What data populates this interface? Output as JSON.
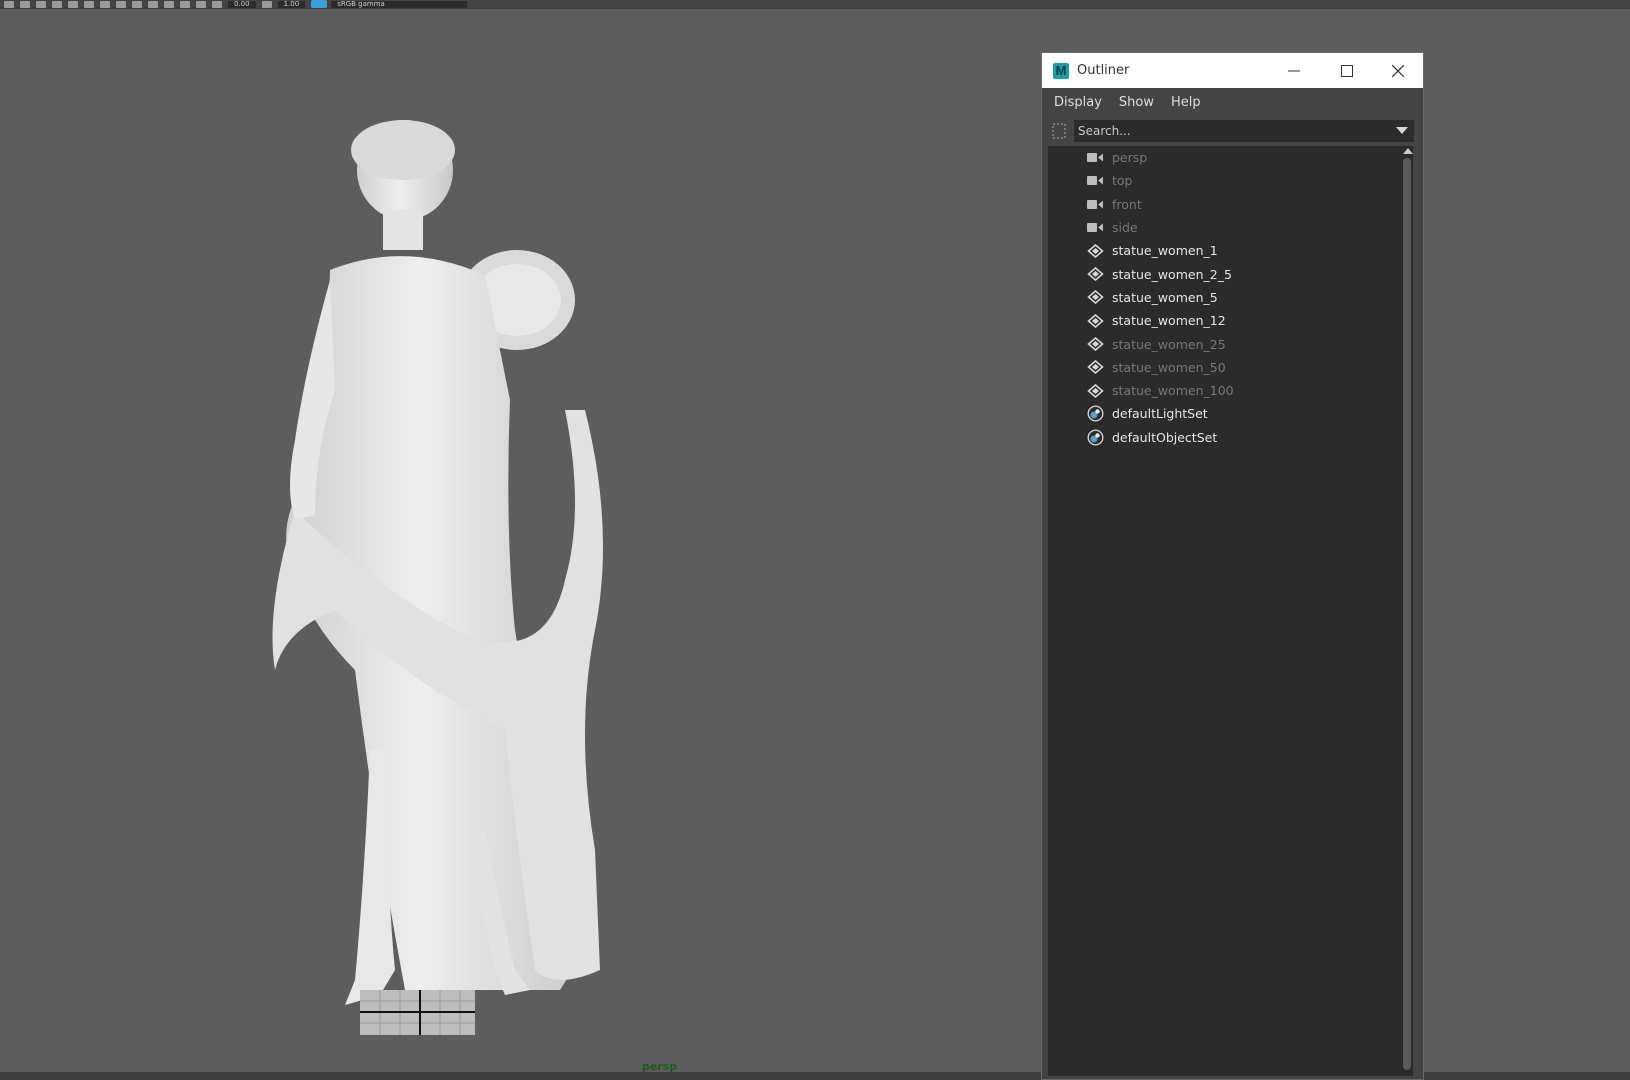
{
  "toolbar": {
    "field1": "0.00",
    "field2": "1.00",
    "color_space": "sRGB gamma"
  },
  "viewport": {
    "camera_label": "persp"
  },
  "outliner": {
    "title": "Outliner",
    "menu": [
      "Display",
      "Show",
      "Help"
    ],
    "search": {
      "placeholder": "Search..."
    },
    "items": [
      {
        "label": "persp",
        "icon": "camera-icon",
        "dim": true
      },
      {
        "label": "top",
        "icon": "camera-icon",
        "dim": true
      },
      {
        "label": "front",
        "icon": "camera-icon",
        "dim": true
      },
      {
        "label": "side",
        "icon": "camera-icon",
        "dim": true
      },
      {
        "label": "statue_women_1",
        "icon": "transform-icon",
        "dim": false
      },
      {
        "label": "statue_women_2_5",
        "icon": "transform-icon",
        "dim": false
      },
      {
        "label": "statue_women_5",
        "icon": "transform-icon",
        "dim": false
      },
      {
        "label": "statue_women_12",
        "icon": "transform-icon",
        "dim": false
      },
      {
        "label": "statue_women_25",
        "icon": "transform-icon",
        "dim": true
      },
      {
        "label": "statue_women_50",
        "icon": "transform-icon",
        "dim": true
      },
      {
        "label": "statue_women_100",
        "icon": "transform-icon",
        "dim": true
      },
      {
        "label": "defaultLightSet",
        "icon": "set-icon",
        "dim": false
      },
      {
        "label": "defaultObjectSet",
        "icon": "set-icon",
        "dim": false
      }
    ]
  }
}
